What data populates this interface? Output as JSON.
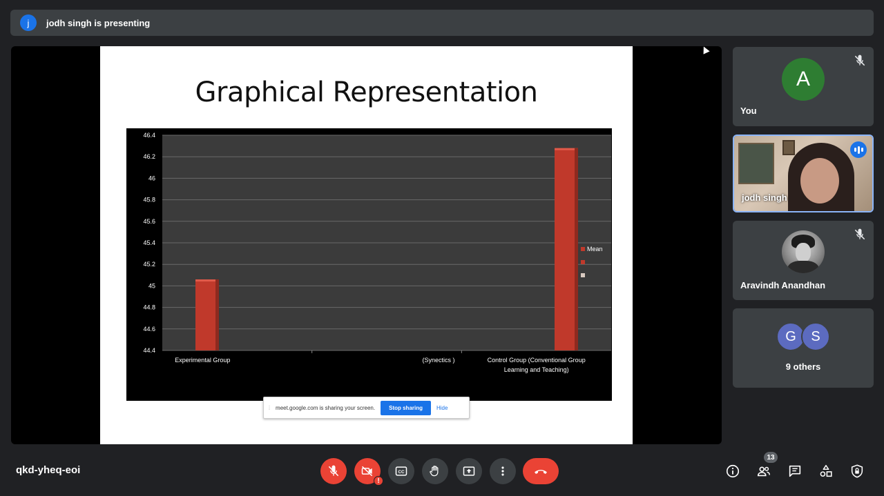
{
  "presenter_bar": {
    "avatar_letter": "j",
    "text": "jodh singh is presenting"
  },
  "slide": {
    "title": "Graphical Representation"
  },
  "chart_data": {
    "type": "bar",
    "title": "",
    "categories": [
      "Experimental Group",
      "(Synectics )",
      "Control Group (Conventional Group Learning and Teaching)"
    ],
    "category_lines": [
      [
        "Experimental Group"
      ],
      [
        "(Synectics )"
      ],
      [
        "Control Group (Conventional Group",
        "Learning and Teaching)"
      ]
    ],
    "series": [
      {
        "name": "Mean",
        "values": [
          45.06,
          null,
          46.28
        ],
        "color": "#c0392b"
      }
    ],
    "yticks": [
      "46.4",
      "46.2",
      "46",
      "45.8",
      "45.6",
      "45.4",
      "45.2",
      "45",
      "44.8",
      "44.6",
      "44.4"
    ],
    "ylim": [
      44.4,
      46.4
    ],
    "legend": [
      "Mean",
      "",
      ""
    ],
    "legend_placement": "right",
    "grid": true
  },
  "share_bar": {
    "message": "meet.google.com is sharing your screen.",
    "stop_label": "Stop sharing",
    "hide_label": "Hide"
  },
  "participants": [
    {
      "name": "You",
      "avatar_letter": "A",
      "muted": true
    },
    {
      "name": "jodh singh",
      "speaking": true
    },
    {
      "name": "Aravindh Anandhan",
      "muted": true
    },
    {
      "name": "9 others",
      "avatars": [
        "G",
        "S"
      ]
    }
  ],
  "bottom": {
    "meeting_code": "qkd-yheq-eoi",
    "people_count": "13",
    "camera_warning": "!",
    "cc_label": "CC"
  },
  "icons": {
    "mic": "mic-off-icon",
    "camera": "camera-off-icon",
    "captions": "captions-icon",
    "hand": "raise-hand-icon",
    "present": "present-icon",
    "more": "more-options-icon",
    "end": "end-call-icon",
    "info": "info-icon",
    "people": "people-icon",
    "chat": "chat-icon",
    "activities": "activities-icon",
    "host": "host-controls-icon"
  },
  "colors": {
    "bg": "#202124",
    "surface": "#3c4043",
    "accent": "#1a73e8",
    "danger": "#ea4335",
    "avatar_green": "#2e7d32",
    "avatar_purple": "#5c6bc0"
  }
}
